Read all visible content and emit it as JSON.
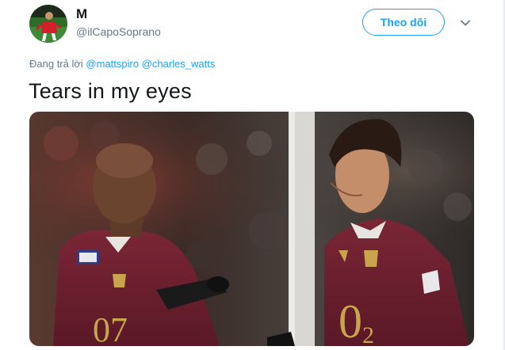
{
  "user": {
    "display_name": "M",
    "handle": "@ilCapoSoprano",
    "avatar_icon": "avatar-photo"
  },
  "header": {
    "follow_label": "Theo dõi",
    "menu_icon": "chevron-down-icon"
  },
  "reply": {
    "prefix": "Đang trả lời",
    "mentions": [
      "@mattspiro",
      "@charles_watts"
    ]
  },
  "tweet": {
    "text": "Tears in my eyes"
  },
  "media": {
    "type": "photo",
    "accent_color": "#6e1f2e"
  },
  "colors": {
    "accent": "#1da1f2",
    "text": "#14171a",
    "secondary": "#657786"
  }
}
